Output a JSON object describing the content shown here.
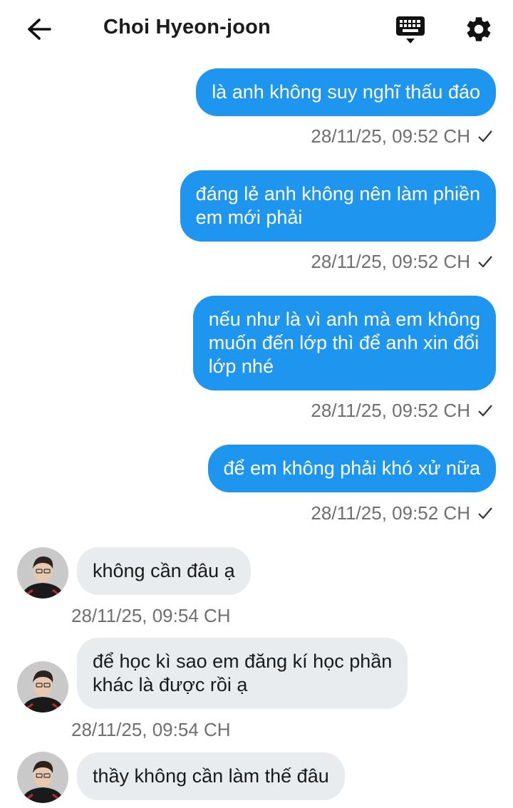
{
  "header": {
    "back_icon": "arrow-left-icon",
    "title": "Choi Hyeon-joon",
    "keyboard_icon": "keyboard-icon",
    "settings_icon": "gear-icon"
  },
  "colors": {
    "outgoing_bubble": "#1e96f0",
    "incoming_bubble": "#e9ecef",
    "timestamp": "#6f6f6f"
  },
  "messages": [
    {
      "direction": "out",
      "lines": [
        "là anh không suy nghĩ thấu đáo"
      ],
      "time": "28/11/25, 09:52 CH",
      "status_icon": "check-icon"
    },
    {
      "direction": "out",
      "lines": [
        "đáng lẻ anh không nên làm phiền",
        "em mới phải"
      ],
      "time": "28/11/25, 09:52 CH",
      "status_icon": "check-icon"
    },
    {
      "direction": "out",
      "lines": [
        "nếu như là vì anh mà em không",
        "muốn đến lớp thì để anh xin đổi",
        "lớp nhé"
      ],
      "time": "28/11/25, 09:52 CH",
      "status_icon": "check-icon"
    },
    {
      "direction": "out",
      "lines": [
        "để em không phải khó xử nữa"
      ],
      "time": "28/11/25, 09:52 CH",
      "status_icon": "check-icon"
    },
    {
      "direction": "in",
      "lines": [
        "không cần đâu ạ"
      ],
      "time": "28/11/25, 09:54 CH"
    },
    {
      "direction": "in",
      "lines": [
        "để học kì sao em đăng kí học phần",
        "khác là được rồi ạ"
      ],
      "time": "28/11/25, 09:54 CH"
    },
    {
      "direction": "in",
      "lines": [
        "thầy không cần làm thế đâu"
      ],
      "time": ""
    }
  ]
}
